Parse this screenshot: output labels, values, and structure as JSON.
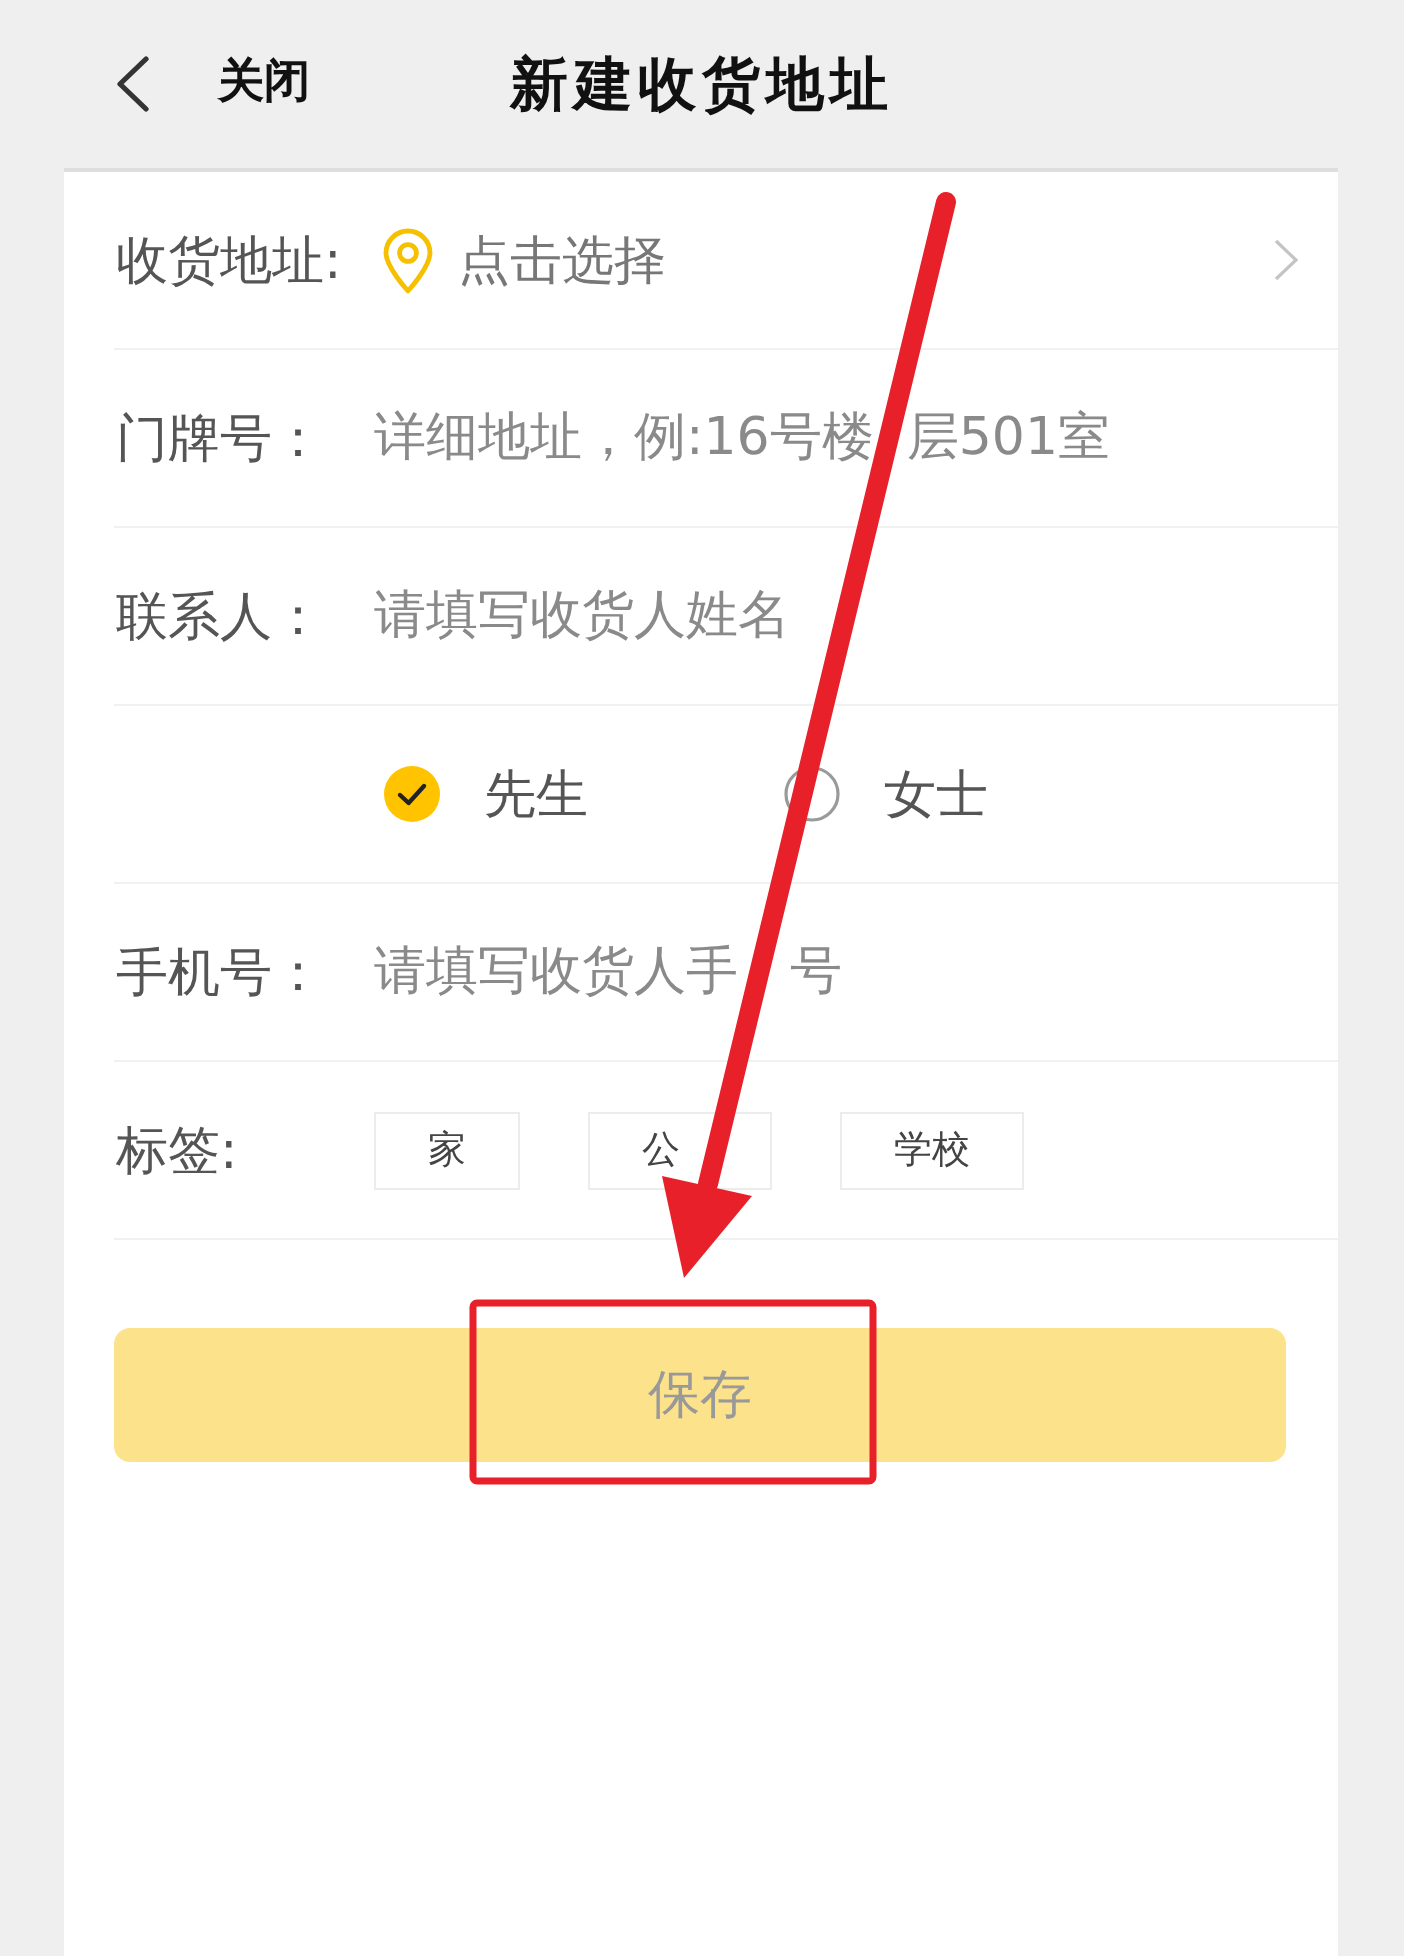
{
  "header": {
    "close_label": "关闭",
    "title": "新建收货地址"
  },
  "form": {
    "rows": [
      {
        "kind": "picker",
        "label": "收货地址:",
        "prompt": "点击选择"
      },
      {
        "kind": "input",
        "label": "门牌号：",
        "placeholder": "详细地址，例:16号楼  层501室"
      },
      {
        "kind": "input",
        "label": "联系人：",
        "placeholder": "请填写收货人姓名"
      },
      {
        "kind": "radio",
        "options": [
          {
            "label": "先生",
            "selected": true
          },
          {
            "label": "女士",
            "selected": false
          }
        ]
      },
      {
        "kind": "input",
        "label": "手机号：",
        "placeholder": "请填写收货人手　号"
      },
      {
        "kind": "tags",
        "label": "标签:",
        "tags": [
          {
            "label": "家",
            "selected": false
          },
          {
            "label": "公　",
            "selected": false
          },
          {
            "label": "学校",
            "selected": false
          }
        ]
      }
    ]
  },
  "save_button": {
    "label": "保存",
    "disabled": true
  }
}
